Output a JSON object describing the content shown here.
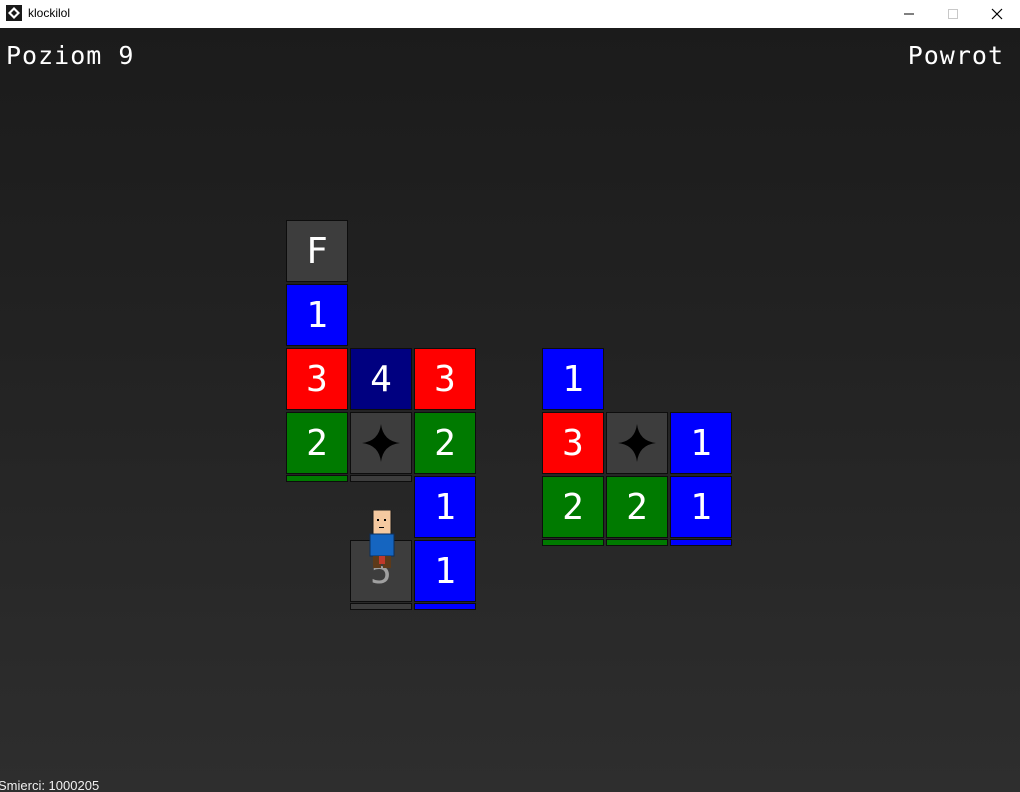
{
  "window": {
    "title": "klockilol",
    "controls": [
      "minimize",
      "maximize",
      "close"
    ]
  },
  "hud": {
    "level": "Poziom 9",
    "back": "Powrot",
    "deaths": "Smierci: 1000205"
  },
  "board": {
    "tiles": {
      "a1": "F",
      "a2": "1",
      "a3": "3",
      "b3": "4",
      "c3": "3",
      "a4": "2",
      "b4": "star",
      "c4": "2",
      "c5": "1",
      "b6": "5",
      "c6": "1",
      "d3": "1",
      "d4": "3",
      "e4": "star",
      "f4": "1",
      "d5": "2",
      "e5": "2",
      "f5": "1"
    },
    "icons": {
      "star": "four-point-star-icon",
      "player": "player-character"
    }
  },
  "colors": {
    "red": "#ff0000",
    "blue": "#0000ff",
    "navy": "#000080",
    "green": "#007a00",
    "gray": "#3d3d3d"
  }
}
